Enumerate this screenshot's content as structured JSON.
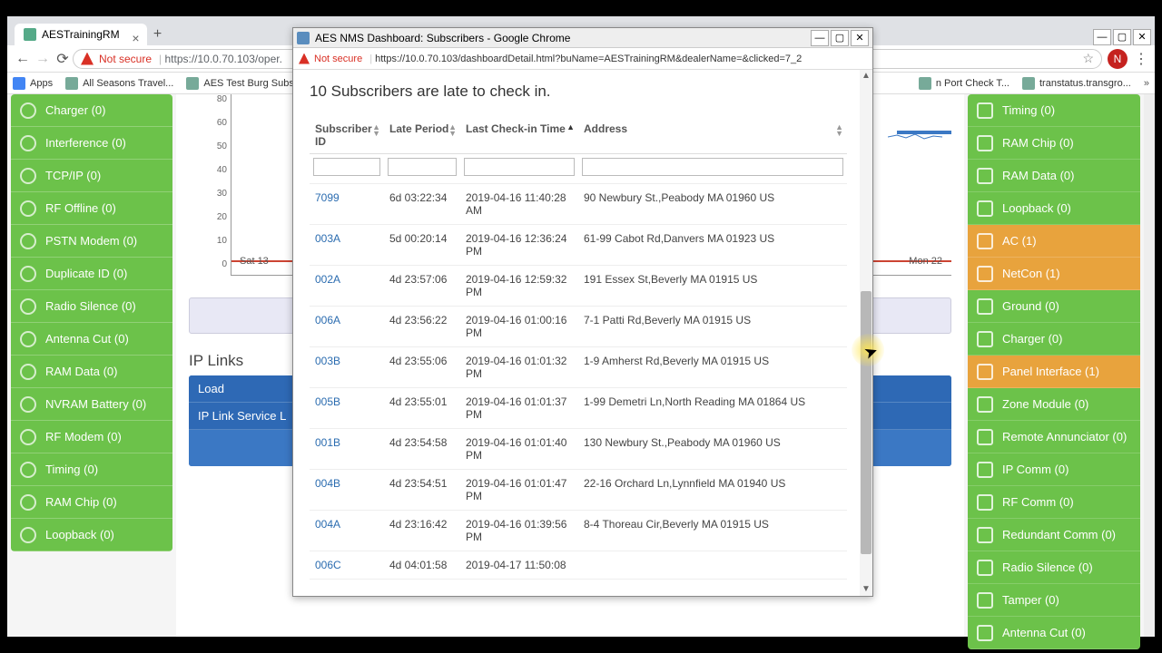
{
  "browser": {
    "tab_title": "AESTrainingRM",
    "not_secure": "Not secure",
    "url_display": "https://10.0.70.103/oper.",
    "avatar_letter": "N",
    "bookmarks": {
      "apps": "Apps",
      "b1": "All Seasons Travel...",
      "b2": "AES Test Burg Subs...",
      "b3": "n Port Check T...",
      "b4": "transtatus.transgro...",
      "more": "»"
    }
  },
  "popup": {
    "title": "AES NMS Dashboard: Subscribers - Google Chrome",
    "not_secure": "Not secure",
    "url": "https://10.0.70.103/dashboardDetail.html?buName=AESTrainingRM&dealerName=&clicked=7_2",
    "heading": "10 Subscribers are late to check in.",
    "columns": {
      "c1": "Subscriber ID",
      "c2": "Late Period",
      "c3": "Last Check-in Time",
      "c4": "Address"
    },
    "rows": [
      {
        "id": "7099",
        "late": "6d 03:22:34",
        "time": "2019-04-16 11:40:28 AM",
        "addr": "90 Newbury St.,Peabody MA 01960 US"
      },
      {
        "id": "003A",
        "late": "5d 00:20:14",
        "time": "2019-04-16 12:36:24 PM",
        "addr": "61-99 Cabot Rd,Danvers MA 01923 US"
      },
      {
        "id": "002A",
        "late": "4d 23:57:06",
        "time": "2019-04-16 12:59:32 PM",
        "addr": "191 Essex St,Beverly MA 01915 US"
      },
      {
        "id": "006A",
        "late": "4d 23:56:22",
        "time": "2019-04-16 01:00:16 PM",
        "addr": "7-1 Patti Rd,Beverly MA 01915 US"
      },
      {
        "id": "003B",
        "late": "4d 23:55:06",
        "time": "2019-04-16 01:01:32 PM",
        "addr": "1-9 Amherst Rd,Beverly MA 01915 US"
      },
      {
        "id": "005B",
        "late": "4d 23:55:01",
        "time": "2019-04-16 01:01:37 PM",
        "addr": "1-99 Demetri Ln,North Reading MA 01864 US"
      },
      {
        "id": "001B",
        "late": "4d 23:54:58",
        "time": "2019-04-16 01:01:40 PM",
        "addr": "130 Newbury St.,Peabody MA 01960 US"
      },
      {
        "id": "004B",
        "late": "4d 23:54:51",
        "time": "2019-04-16 01:01:47 PM",
        "addr": "22-16 Orchard Ln,Lynnfield MA 01940 US"
      },
      {
        "id": "004A",
        "late": "4d 23:16:42",
        "time": "2019-04-16 01:39:56 PM",
        "addr": "8-4 Thoreau Cir,Beverly MA 01915 US"
      },
      {
        "id": "006C",
        "late": "4d 04:01:58",
        "time": "2019-04-17 11:50:08",
        "addr": ""
      }
    ]
  },
  "left_sidebar": [
    "Charger (0)",
    "Interference (0)",
    "TCP/IP (0)",
    "RF Offline (0)",
    "PSTN Modem (0)",
    "Duplicate ID (0)",
    "Radio Silence (0)",
    "Antenna Cut (0)",
    "RAM Data (0)",
    "NVRAM Battery (0)",
    "RF Modem (0)",
    "Timing (0)",
    "RAM Chip (0)",
    "Loopback (0)"
  ],
  "right_sidebar": [
    {
      "label": "Timing (0)",
      "c": "g"
    },
    {
      "label": "RAM Chip (0)",
      "c": "g"
    },
    {
      "label": "RAM Data (0)",
      "c": "g"
    },
    {
      "label": "Loopback (0)",
      "c": "g"
    },
    {
      "label": "AC (1)",
      "c": "o"
    },
    {
      "label": "NetCon (1)",
      "c": "o"
    },
    {
      "label": "Ground (0)",
      "c": "g"
    },
    {
      "label": "Charger (0)",
      "c": "g"
    },
    {
      "label": "Panel Interface (1)",
      "c": "o"
    },
    {
      "label": "Zone Module (0)",
      "c": "g"
    },
    {
      "label": "Remote Annunciator (0)",
      "c": "g"
    },
    {
      "label": "IP Comm (0)",
      "c": "g"
    },
    {
      "label": "RF Comm (0)",
      "c": "g"
    },
    {
      "label": "Redundant Comm (0)",
      "c": "g"
    },
    {
      "label": "Radio Silence (0)",
      "c": "g"
    },
    {
      "label": "Tamper (0)",
      "c": "g"
    },
    {
      "label": "Antenna Cut (0)",
      "c": "g"
    }
  ],
  "chart": {
    "y_ticks": [
      "80",
      "60",
      "50",
      "40",
      "30",
      "20",
      "10",
      "0"
    ],
    "x_left": "Sat 13",
    "x_right": "Mon 22"
  },
  "iplinks": {
    "title": "IP Links",
    "row1": "Load",
    "row2": "IP Link Service L"
  }
}
